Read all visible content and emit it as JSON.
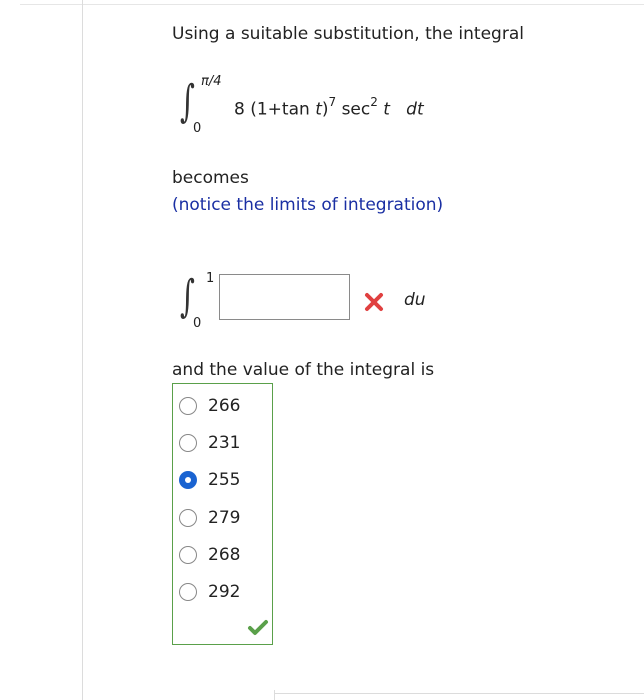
{
  "question": {
    "prompt": "Using a suitable substitution, the integral",
    "original_integral": {
      "upper_limit": "π/4",
      "lower_limit": "0",
      "coefficient": "8",
      "base": "(1+tan ",
      "base_var": "t",
      "base_close": ")",
      "exponent": "7",
      "sec": "sec",
      "sec_exponent": "2",
      "sec_var": "t",
      "differential": "dt"
    },
    "becomes_text": "becomes",
    "notice_text": "(notice the limits of integration)",
    "new_integral": {
      "upper_limit": "1",
      "lower_limit": "0",
      "answer_value": "",
      "status": "incorrect",
      "status_icon": "x-mark-icon",
      "differential": "du"
    },
    "value_prompt": "and the value of the integral is",
    "choices": [
      {
        "label": "266",
        "selected": false
      },
      {
        "label": "231",
        "selected": false
      },
      {
        "label": "255",
        "selected": true
      },
      {
        "label": "279",
        "selected": false
      },
      {
        "label": "268",
        "selected": false
      },
      {
        "label": "292",
        "selected": false
      }
    ],
    "choices_status": "correct",
    "choices_status_icon": "check-mark-icon"
  },
  "colors": {
    "link_blue": "#1a2fa3",
    "correct_green": "#5aa04a",
    "incorrect_red": "#e04040",
    "radio_selected": "#1a63d1"
  }
}
